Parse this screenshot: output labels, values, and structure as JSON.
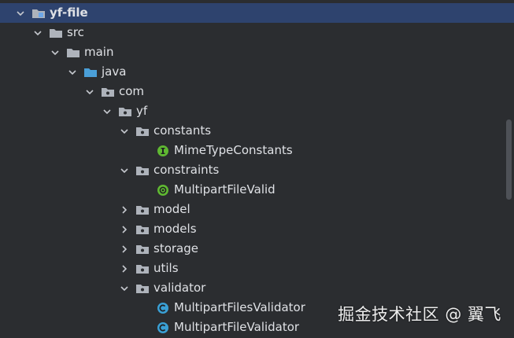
{
  "project_tree": {
    "root": {
      "label": "yf-file"
    },
    "src": {
      "label": "src"
    },
    "main": {
      "label": "main"
    },
    "java": {
      "label": "java"
    },
    "com": {
      "label": "com"
    },
    "yf": {
      "label": "yf"
    },
    "constants": {
      "label": "constants"
    },
    "mime_type_constants": {
      "label": "MimeTypeConstants"
    },
    "constraints": {
      "label": "constraints"
    },
    "multipart_file_valid": {
      "label": "MultipartFileValid"
    },
    "model": {
      "label": "model"
    },
    "models": {
      "label": "models"
    },
    "storage": {
      "label": "storage"
    },
    "utils": {
      "label": "utils"
    },
    "validator": {
      "label": "validator"
    },
    "multipart_files_validator": {
      "label": "MultipartFilesValidator"
    },
    "multipart_file_validator": {
      "label": "MultipartFileValidator"
    }
  },
  "colors": {
    "background": "#2b2d30",
    "selected_row": "#2e436e",
    "folder_gray": "#aeb3bb",
    "source_folder_blue": "#4a9fd8",
    "module_blue": "#6fa8e8",
    "interface_green": "#5fb832",
    "annotation_green": "#5fb832",
    "class_teal": "#3aa0d5"
  },
  "icons": {
    "module": "module-folder-icon",
    "folder": "folder-icon",
    "source_root": "source-root-folder-icon",
    "package": "package-icon",
    "interface": "interface-icon",
    "annotation": "annotation-icon",
    "class": "class-icon"
  },
  "watermark": {
    "text": "掘金技术社区 @ 翼飞"
  }
}
